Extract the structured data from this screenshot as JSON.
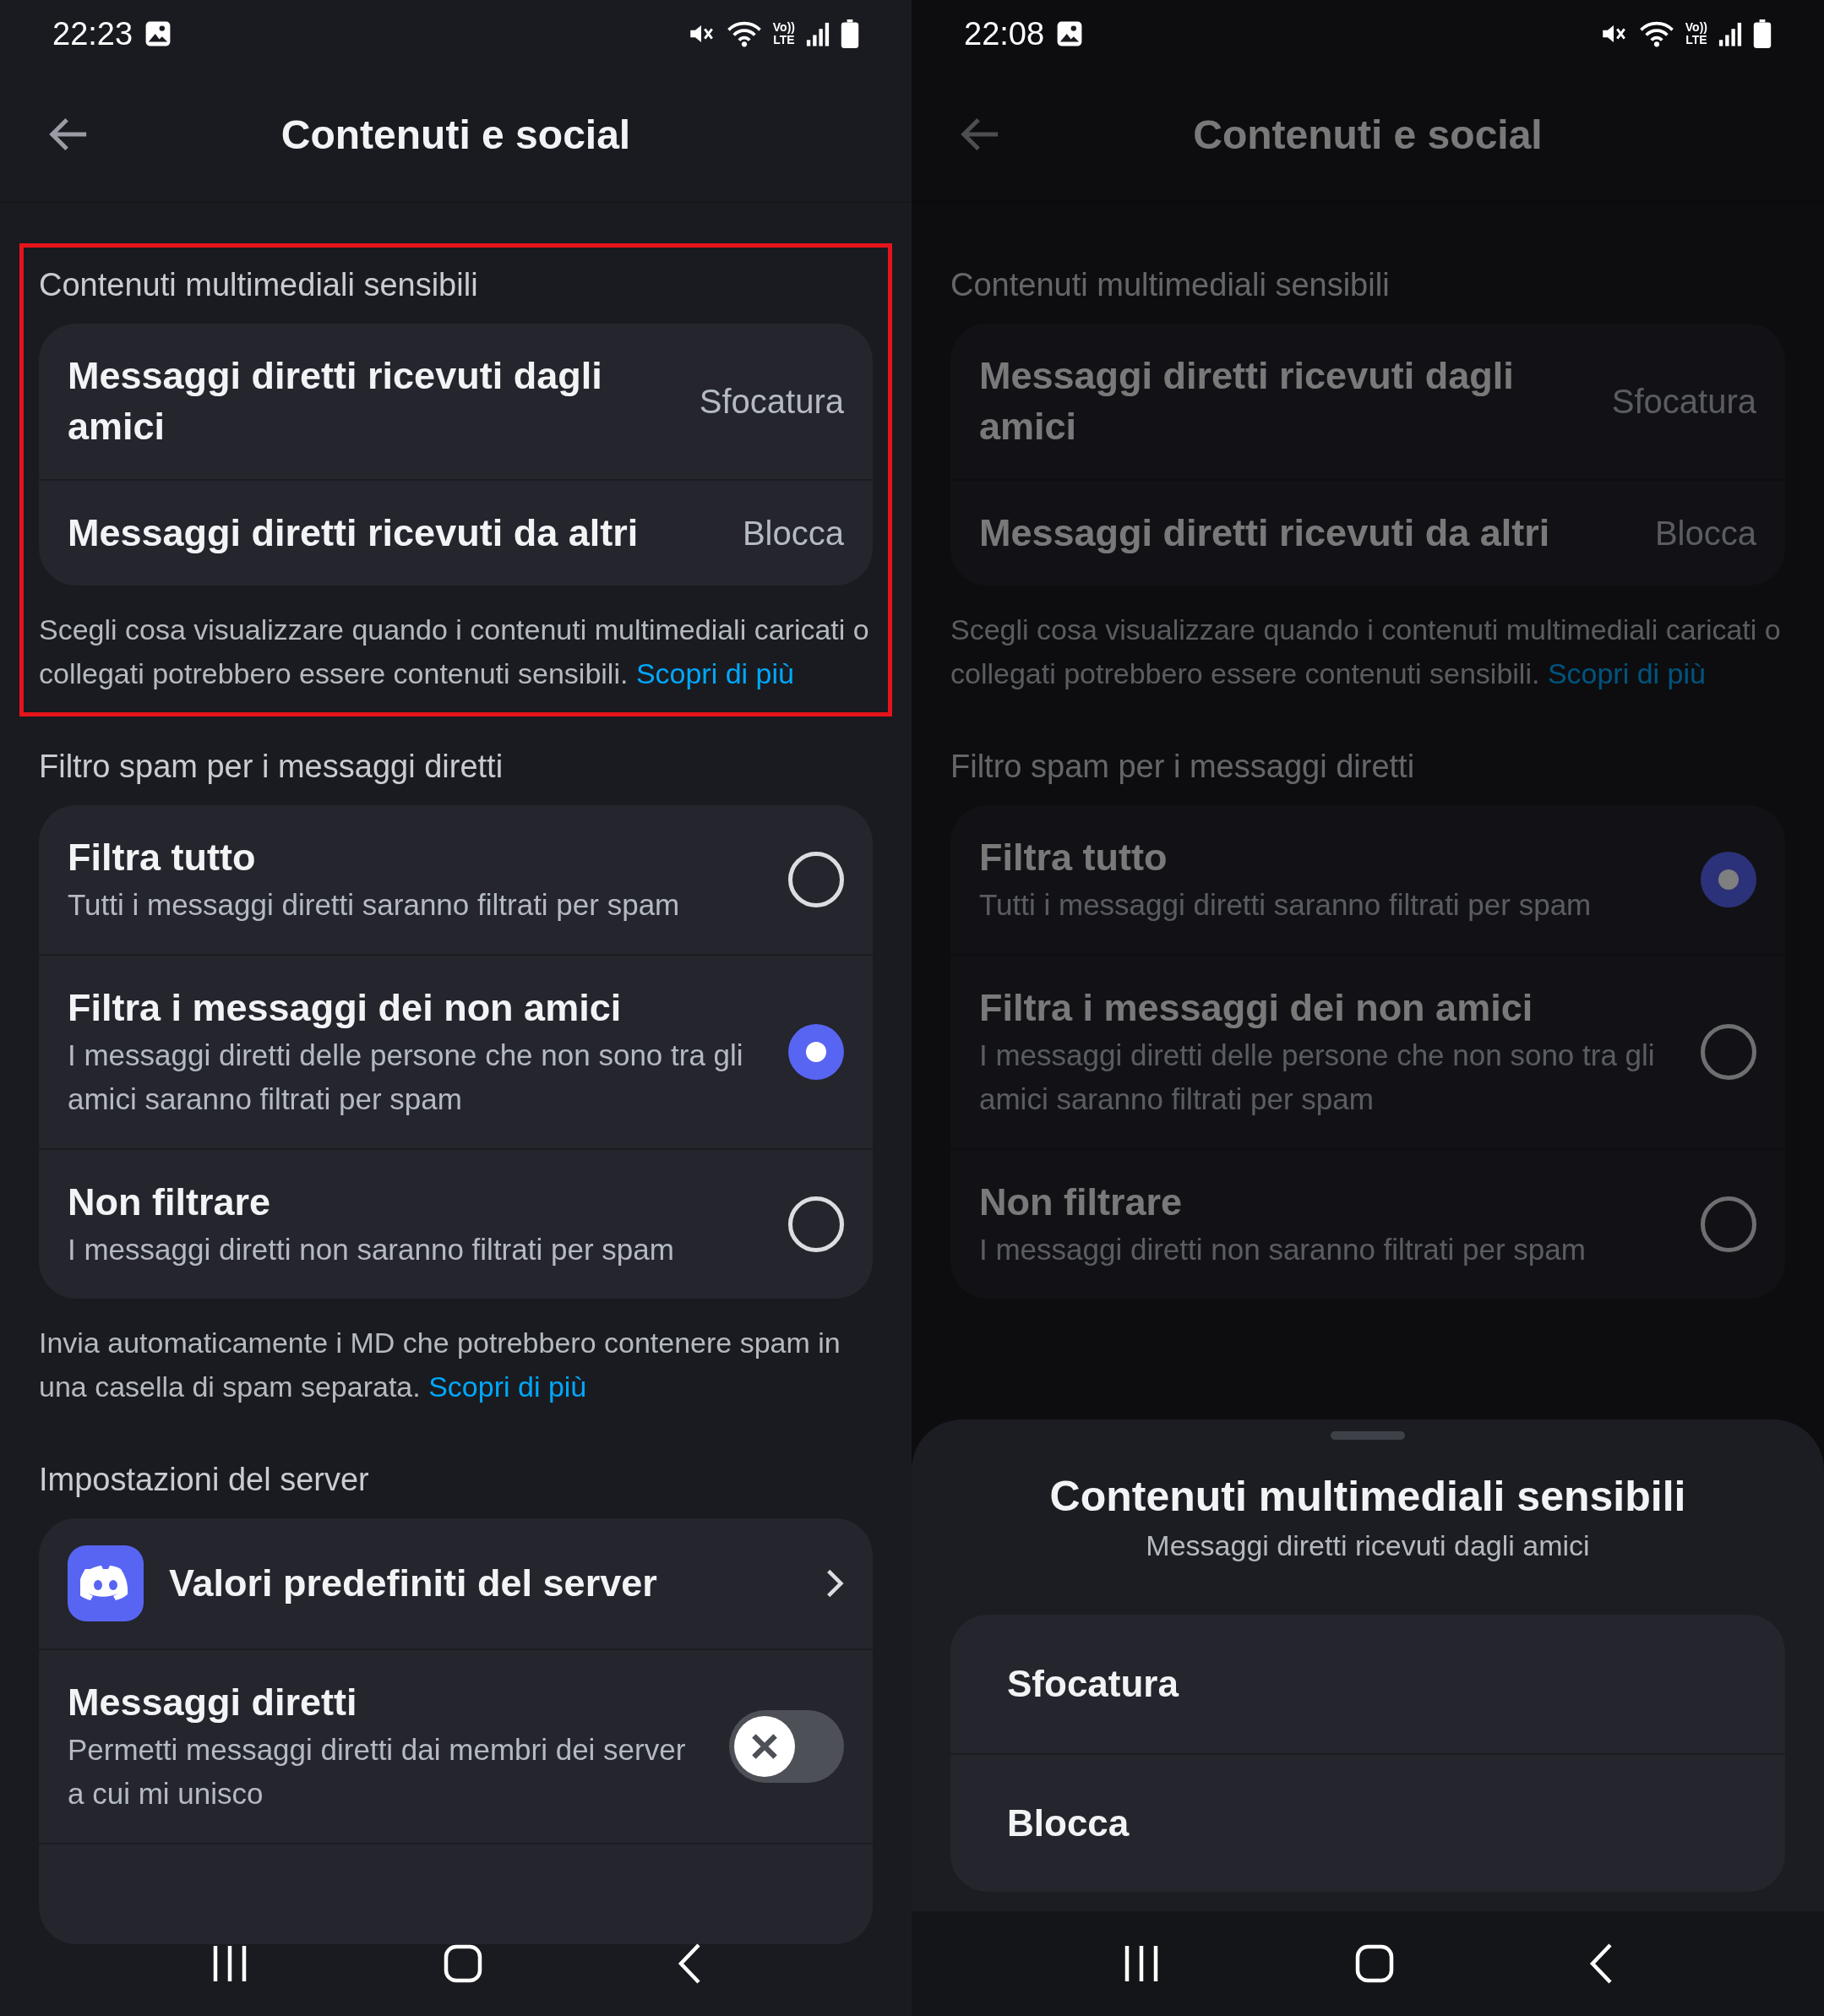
{
  "screens": [
    {
      "dimmed": false,
      "nav_bar_solid": false,
      "status_bar": {
        "time": "22:23",
        "volte": "Vo))",
        "network": "LTE"
      },
      "header": {
        "title": "Contenuti e social"
      },
      "sections": [
        {
          "label": "Contenuti multimediali sensibili",
          "highlighted": true,
          "items": [
            {
              "kind": "value",
              "title": "Messaggi diretti ricevuti dagli amici",
              "value": "Sfocatura"
            },
            {
              "kind": "value",
              "title": "Messaggi diretti ricevuti da altri",
              "value": "Blocca"
            }
          ],
          "footer": "Scegli cosa visualizzare quando i contenuti multimediali caricati o collegati potrebbero essere contenuti sensibili.",
          "footer_link": "Scopri di più"
        },
        {
          "label": "Filtro spam per i messaggi diretti",
          "highlighted": false,
          "items": [
            {
              "kind": "radio",
              "title": "Filtra tutto",
              "description": "Tutti i messaggi diretti saranno filtrati per spam",
              "selected": false
            },
            {
              "kind": "radio",
              "title": "Filtra i messaggi dei non amici",
              "description": "I messaggi diretti delle persone che non sono tra gli amici saranno filtrati per spam",
              "selected": true
            },
            {
              "kind": "radio",
              "title": "Non filtrare",
              "description": "I messaggi diretti non saranno filtrati per spam",
              "selected": false
            }
          ],
          "footer": "Invia automaticamente i MD che potrebbero contenere spam in una casella di spam separata.",
          "footer_link": "Scopri di più"
        },
        {
          "label": "Impostazioni del server",
          "highlighted": false,
          "items": [
            {
              "kind": "link",
              "title": "Valori predefiniti del server"
            },
            {
              "kind": "toggle",
              "title": "Messaggi diretti",
              "description": "Permetti messaggi diretti dai membri dei server a cui mi unisco",
              "on": false
            },
            {
              "kind": "blank"
            }
          ]
        }
      ]
    },
    {
      "dimmed": true,
      "nav_bar_solid": true,
      "status_bar": {
        "time": "22:08",
        "volte": "Vo))",
        "network": "LTE"
      },
      "header": {
        "title": "Contenuti e social"
      },
      "sections": [
        {
          "label": "Contenuti multimediali sensibili",
          "highlighted": false,
          "items": [
            {
              "kind": "value",
              "title": "Messaggi diretti ricevuti dagli amici",
              "value": "Sfocatura"
            },
            {
              "kind": "value",
              "title": "Messaggi diretti ricevuti da altri",
              "value": "Blocca"
            }
          ],
          "footer": "Scegli cosa visualizzare quando i contenuti multimediali caricati o collegati potrebbero essere contenuti sensibili.",
          "footer_link": "Scopri di più"
        },
        {
          "label": "Filtro spam per i messaggi diretti",
          "highlighted": false,
          "items": [
            {
              "kind": "radio",
              "title": "Filtra tutto",
              "description": "Tutti i messaggi diretti saranno filtrati per spam",
              "selected": true
            },
            {
              "kind": "radio",
              "title": "Filtra i messaggi dei non amici",
              "description": "I messaggi diretti delle persone che non sono tra gli amici saranno filtrati per spam",
              "selected": false
            },
            {
              "kind": "radio",
              "title": "Non filtrare",
              "description": "I messaggi diretti non saranno filtrati per spam",
              "selected": false
            }
          ]
        }
      ],
      "sheet": {
        "title": "Contenuti multimediali sensibili",
        "subtitle": "Messaggi diretti ricevuti dagli amici",
        "options": [
          "Sfocatura",
          "Blocca"
        ]
      }
    }
  ]
}
